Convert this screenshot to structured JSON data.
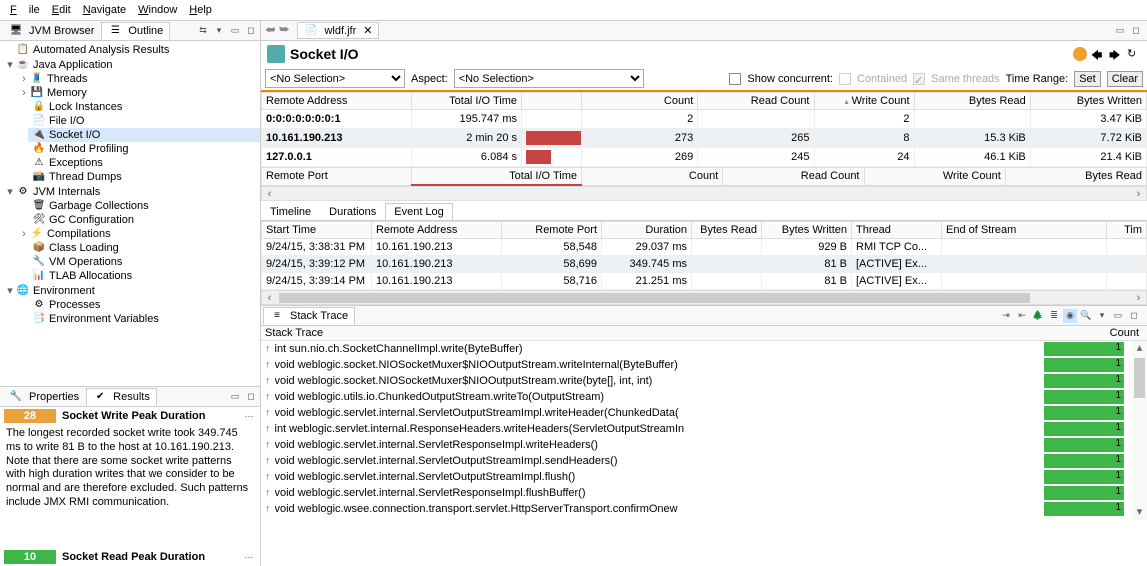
{
  "menu": {
    "file": "File",
    "edit": "Edit",
    "navigate": "Navigate",
    "window": "Window",
    "help": "Help"
  },
  "left_tabs": {
    "jvm": "JVM Browser",
    "outline": "Outline"
  },
  "tree": {
    "n0": "Automated Analysis Results",
    "n1": "Java Application",
    "n1a": "Threads",
    "n1b": "Memory",
    "n1c": "Lock Instances",
    "n1d": "File I/O",
    "n1e": "Socket I/O",
    "n1f": "Method Profiling",
    "n1g": "Exceptions",
    "n1h": "Thread Dumps",
    "n2": "JVM Internals",
    "n2a": "Garbage Collections",
    "n2b": "GC Configuration",
    "n2c": "Compilations",
    "n2d": "Class Loading",
    "n2e": "VM Operations",
    "n2f": "TLAB Allocations",
    "n3": "Environment",
    "n3a": "Processes",
    "n3b": "Environment Variables"
  },
  "props_tabs": {
    "p": "Properties",
    "r": "Results"
  },
  "rules": {
    "r1": {
      "score": "28",
      "title": "Socket Write Peak Duration"
    },
    "r1desc": "The longest recorded socket write took 349.745 ms to write 81 B to the host at 10.161.190.213. Note that there are some socket write patterns with high duration writes that we consider to be normal and are therefore excluded. Such patterns include JMX RMI communication.",
    "r2": {
      "score": "10",
      "title": "Socket Read Peak Duration"
    }
  },
  "editor": {
    "tab": "wldf.jfr",
    "title": "Socket I/O",
    "aspect_lbl": "Aspect:",
    "no_sel": "<No Selection>",
    "show_concurrent": "Show concurrent:",
    "contained": "Contained",
    "same_threads": "Same threads",
    "time_range": "Time Range:",
    "set": "Set",
    "clear": "Clear"
  },
  "top_cols": {
    "addr": "Remote Address",
    "tio": "Total I/O Time",
    "count": "Count",
    "rc": "Read Count",
    "wc": "Write Count",
    "br": "Bytes Read",
    "bw": "Bytes Written"
  },
  "top_rows": [
    {
      "addr": "0:0:0:0:0:0:0:1",
      "tio": "195.747 ms",
      "bar": 0,
      "count": "2",
      "rc": "",
      "wc": "2",
      "br": "",
      "bw": "3.47 KiB"
    },
    {
      "addr": "10.161.190.213",
      "tio": "2 min 20 s",
      "bar": 60,
      "count": "273",
      "rc": "265",
      "wc": "8",
      "br": "15.3 KiB",
      "bw": "7.72 KiB",
      "sel": true
    },
    {
      "addr": "127.0.0.1",
      "tio": "6.084 s",
      "bar": 25,
      "count": "269",
      "rc": "245",
      "wc": "24",
      "br": "46.1 KiB",
      "bw": "21.4 KiB"
    }
  ],
  "mid_cols": {
    "port": "Remote Port",
    "tio": "Total I/O Time",
    "count": "Count",
    "rc": "Read Count",
    "wc": "Write Count",
    "br": "Bytes Read"
  },
  "subtabs": {
    "t": "Timeline",
    "d": "Durations",
    "e": "Event Log"
  },
  "event_cols": {
    "start": "Start Time",
    "addr": "Remote Address",
    "port": "Remote Port",
    "dur": "Duration",
    "br": "Bytes Read",
    "bw": "Bytes Written",
    "thread": "Thread",
    "eos": "End of Stream",
    "time": "Tim"
  },
  "events": [
    {
      "start": "9/24/15, 3:38:31 PM",
      "addr": "10.161.190.213",
      "port": "58,548",
      "dur": "29.037 ms",
      "br": "",
      "bw": "929 B",
      "thread": "RMI TCP Co...",
      "eos": ""
    },
    {
      "start": "9/24/15, 3:39:12 PM",
      "addr": "10.161.190.213",
      "port": "58,699",
      "dur": "349.745 ms",
      "br": "",
      "bw": "81 B",
      "thread": "[ACTIVE] Ex...",
      "eos": "",
      "sel": true
    },
    {
      "start": "9/24/15, 3:39:14 PM",
      "addr": "10.161.190.213",
      "port": "58,716",
      "dur": "21.251 ms",
      "br": "",
      "bw": "81 B",
      "thread": "[ACTIVE] Ex...",
      "eos": ""
    }
  ],
  "stack": {
    "title": "Stack Trace",
    "hdr_trace": "Stack Trace",
    "hdr_count": "Count",
    "rows": [
      "int sun.nio.ch.SocketChannelImpl.write(ByteBuffer)",
      "void weblogic.socket.NIOSocketMuxer$NIOOutputStream.writeInternal(ByteBuffer)",
      "void weblogic.socket.NIOSocketMuxer$NIOOutputStream.write(byte[], int, int)",
      "void weblogic.utils.io.ChunkedOutputStream.writeTo(OutputStream)",
      "void weblogic.servlet.internal.ServletOutputStreamImpl.writeHeader(ChunkedData(",
      "int weblogic.servlet.internal.ResponseHeaders.writeHeaders(ServletOutputStreamIn",
      "void weblogic.servlet.internal.ServletResponseImpl.writeHeaders()",
      "void weblogic.servlet.internal.ServletOutputStreamImpl.sendHeaders()",
      "void weblogic.servlet.internal.ServletOutputStreamImpl.flush()",
      "void weblogic.servlet.internal.ServletResponseImpl.flushBuffer()",
      "void weblogic.wsee.connection.transport.servlet.HttpServerTransport.confirmOnew"
    ],
    "count": "1"
  }
}
